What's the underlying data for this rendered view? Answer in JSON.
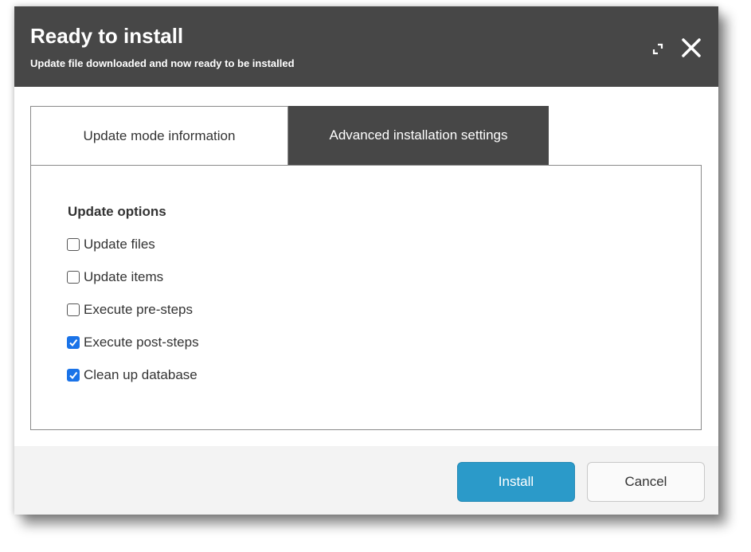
{
  "dialog": {
    "title": "Ready to install",
    "subtitle": "Update file downloaded and now ready to be installed"
  },
  "header_icons": {
    "maximize": "maximize-icon",
    "close": "close-icon"
  },
  "tabs": [
    {
      "label": "Update mode information",
      "active": false
    },
    {
      "label": "Advanced installation settings",
      "active": true
    }
  ],
  "update_options": {
    "heading": "Update options",
    "items": [
      {
        "label": "Update files",
        "checked": false
      },
      {
        "label": "Update items",
        "checked": false
      },
      {
        "label": "Execute pre-steps",
        "checked": false
      },
      {
        "label": "Execute post-steps",
        "checked": true
      },
      {
        "label": "Clean up database",
        "checked": true
      }
    ]
  },
  "buttons": {
    "install": "Install",
    "cancel": "Cancel"
  },
  "colors": {
    "header_bg": "#474747",
    "checkbox_checked": "#1a73e8",
    "install_button": "#2b9ac9"
  }
}
